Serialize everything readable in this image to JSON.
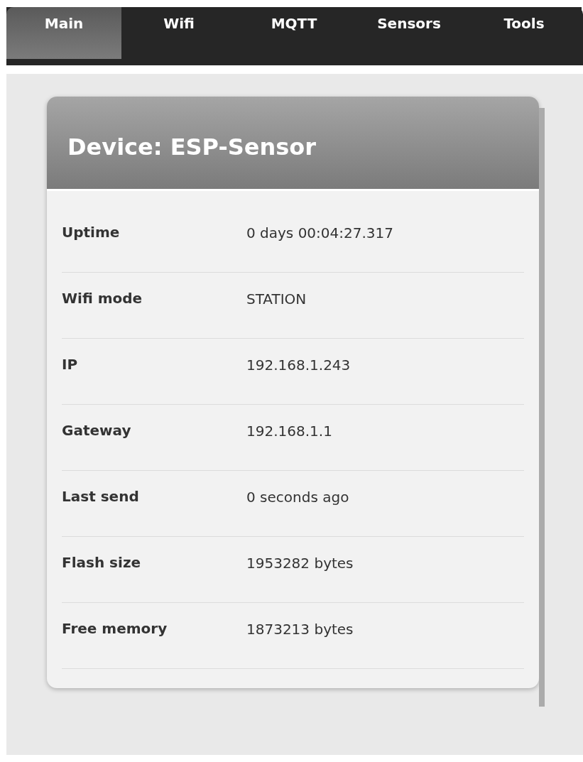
{
  "tabs": [
    {
      "label": "Main",
      "selected": true
    },
    {
      "label": "Wifi",
      "selected": false
    },
    {
      "label": "MQTT",
      "selected": false
    },
    {
      "label": "Sensors",
      "selected": false
    },
    {
      "label": "Tools",
      "selected": false
    }
  ],
  "card": {
    "title": "Device: ESP-Sensor",
    "rows": [
      {
        "label": "Uptime",
        "value": "0 days 00:04:27.317"
      },
      {
        "label": "Wifi mode",
        "value": "STATION"
      },
      {
        "label": "IP",
        "value": "192.168.1.243"
      },
      {
        "label": "Gateway",
        "value": "192.168.1.1"
      },
      {
        "label": "Last send",
        "value": "0 seconds ago"
      },
      {
        "label": "Flash size",
        "value": "1953282 bytes"
      },
      {
        "label": "Free memory",
        "value": "1873213 bytes"
      }
    ]
  }
}
